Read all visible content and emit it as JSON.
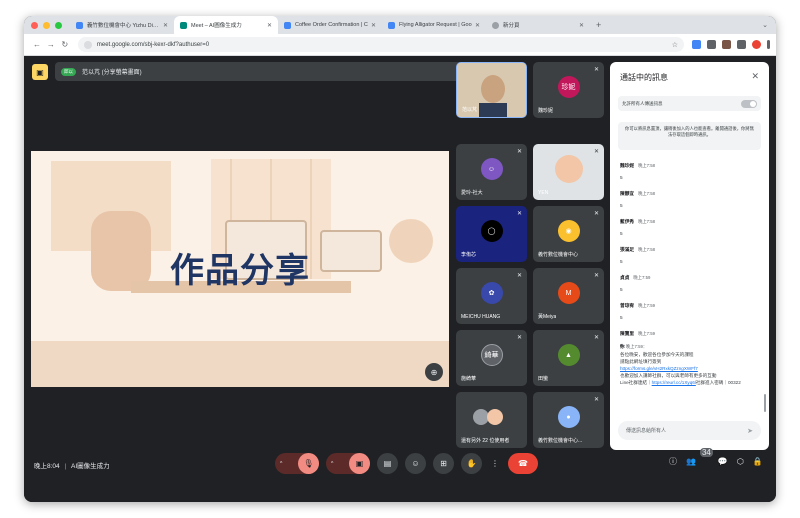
{
  "browser": {
    "tabs": [
      {
        "label": "義竹數位機會中心 Yizhu Digita",
        "color": "#4285f4",
        "active": false
      },
      {
        "label": "Meet – AI圖像生成力",
        "color": "#00897b",
        "active": true
      },
      {
        "label": "Coffee Order Confirmation | C",
        "color": "#4285f4",
        "active": false
      },
      {
        "label": "Flying Alligator Request | Goo",
        "color": "#4285f4",
        "active": false
      },
      {
        "label": "新分頁",
        "color": "#9aa0a6",
        "active": false
      }
    ],
    "url": "meet.google.com/sbj-kexr-dkf?authuser=0"
  },
  "presenting": {
    "avatar": "邱以",
    "text": "范以芃 (分享螢幕畫面)"
  },
  "slide": {
    "title": "作品分享"
  },
  "participants": [
    {
      "name": "范以芃",
      "avatar": "",
      "color": "#e6d7c1",
      "muted": false
    },
    {
      "name": "魏珍妮",
      "avatar": "珍妮",
      "color": "#c2185b",
      "muted": true
    },
    {
      "name": "愛玲-社大",
      "avatar": "",
      "color": "#7e57c2",
      "muted": true
    },
    {
      "name": "YEN",
      "avatar": "",
      "color": "#cfd8dc",
      "muted": true
    },
    {
      "name": "李侑芯",
      "avatar": "",
      "color": "#283593",
      "muted": true
    },
    {
      "name": "義竹數位機會中心",
      "avatar": "",
      "color": "#fbc02d",
      "muted": true
    },
    {
      "name": "MEICHU HUANG",
      "avatar": "",
      "color": "#3949ab",
      "muted": true
    },
    {
      "name": "黃Meiya",
      "avatar": "M",
      "color": "#e64a19",
      "muted": true
    },
    {
      "name": "施綺華",
      "avatar": "綺華",
      "color": "#5f6368",
      "muted": true
    },
    {
      "name": "田蠻",
      "avatar": "",
      "color": "#558b2f",
      "muted": true
    },
    {
      "name": "還有另外 22 位使用者",
      "avatar": "",
      "color": "#5f6368",
      "muted": false
    },
    {
      "name": "義竹數位機會中心...",
      "avatar": "",
      "color": "#8ab4f8",
      "muted": true
    }
  ],
  "chat": {
    "header": "通話中的訊息",
    "allow_label": "允許所有人傳送訊息",
    "notice": "你可以將訊息置頂，讓稍後加入的人也能查看。離開通話後，你將無法存取這個即時通訊。",
    "messages": [
      {
        "sender": "魏珍妮",
        "time": "晚上7:58",
        "text": "5"
      },
      {
        "sender": "陳靜宜",
        "time": "晚上7:58",
        "text": "5"
      },
      {
        "sender": "藍伊秀",
        "time": "晚上7:58",
        "text": "5"
      },
      {
        "sender": "張滿足",
        "time": "晚上7:58",
        "text": "5"
      },
      {
        "sender": "貞貞",
        "time": "晚上7:59",
        "text": "5"
      },
      {
        "sender": "曾琼宥",
        "time": "晚上7:59",
        "text": "5"
      },
      {
        "sender": "陳寶里",
        "time": "晚上7:59",
        "text": "5"
      }
    ],
    "last_message": {
      "sender": "你",
      "time": "晚上7:59：",
      "line1": "各位晚安，歡迎各位參加今天的課程",
      "line2": "請點此網址填行簽到",
      "link1": "https://forms.gle/vH2RxkQZzngXWFf7",
      "line3": "也歡迎加入講師社群，可以與老師有更多的互動",
      "line4_prefix": "Line社群連結｜",
      "link2": "https://reurl.cc/1Xyq6l",
      "line4_suffix": "社群進入密碼｜00322"
    },
    "input_placeholder": "傳送訊息給所有人"
  },
  "bottom": {
    "time": "晚上8:04",
    "meeting": "AI圖像生成力",
    "people_count": "34"
  }
}
